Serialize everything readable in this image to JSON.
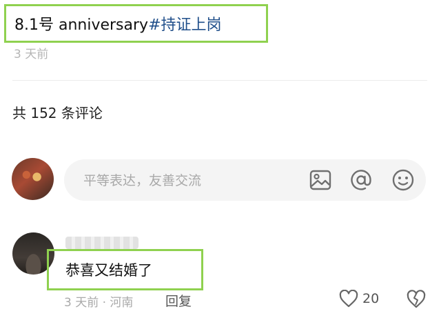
{
  "post": {
    "title_prefix": "8.1号 anniversary",
    "hashtag": "#持证上岗",
    "time": "3 天前"
  },
  "comments_header": {
    "count_text": "共 152 条评论"
  },
  "composer": {
    "placeholder": "平等表达，友善交流",
    "icons": [
      "image-icon",
      "at-mention-icon",
      "emoji-icon"
    ]
  },
  "comment": {
    "text": "恭喜又结婚了",
    "meta": "3 天前 · 河南",
    "reply_label": "回复",
    "likes": "20"
  },
  "colors": {
    "highlight_box": "#8fd14f",
    "hashtag": "#1f4e8a",
    "muted_text": "#a9a9a9",
    "composer_bg": "#f4f4f4"
  }
}
